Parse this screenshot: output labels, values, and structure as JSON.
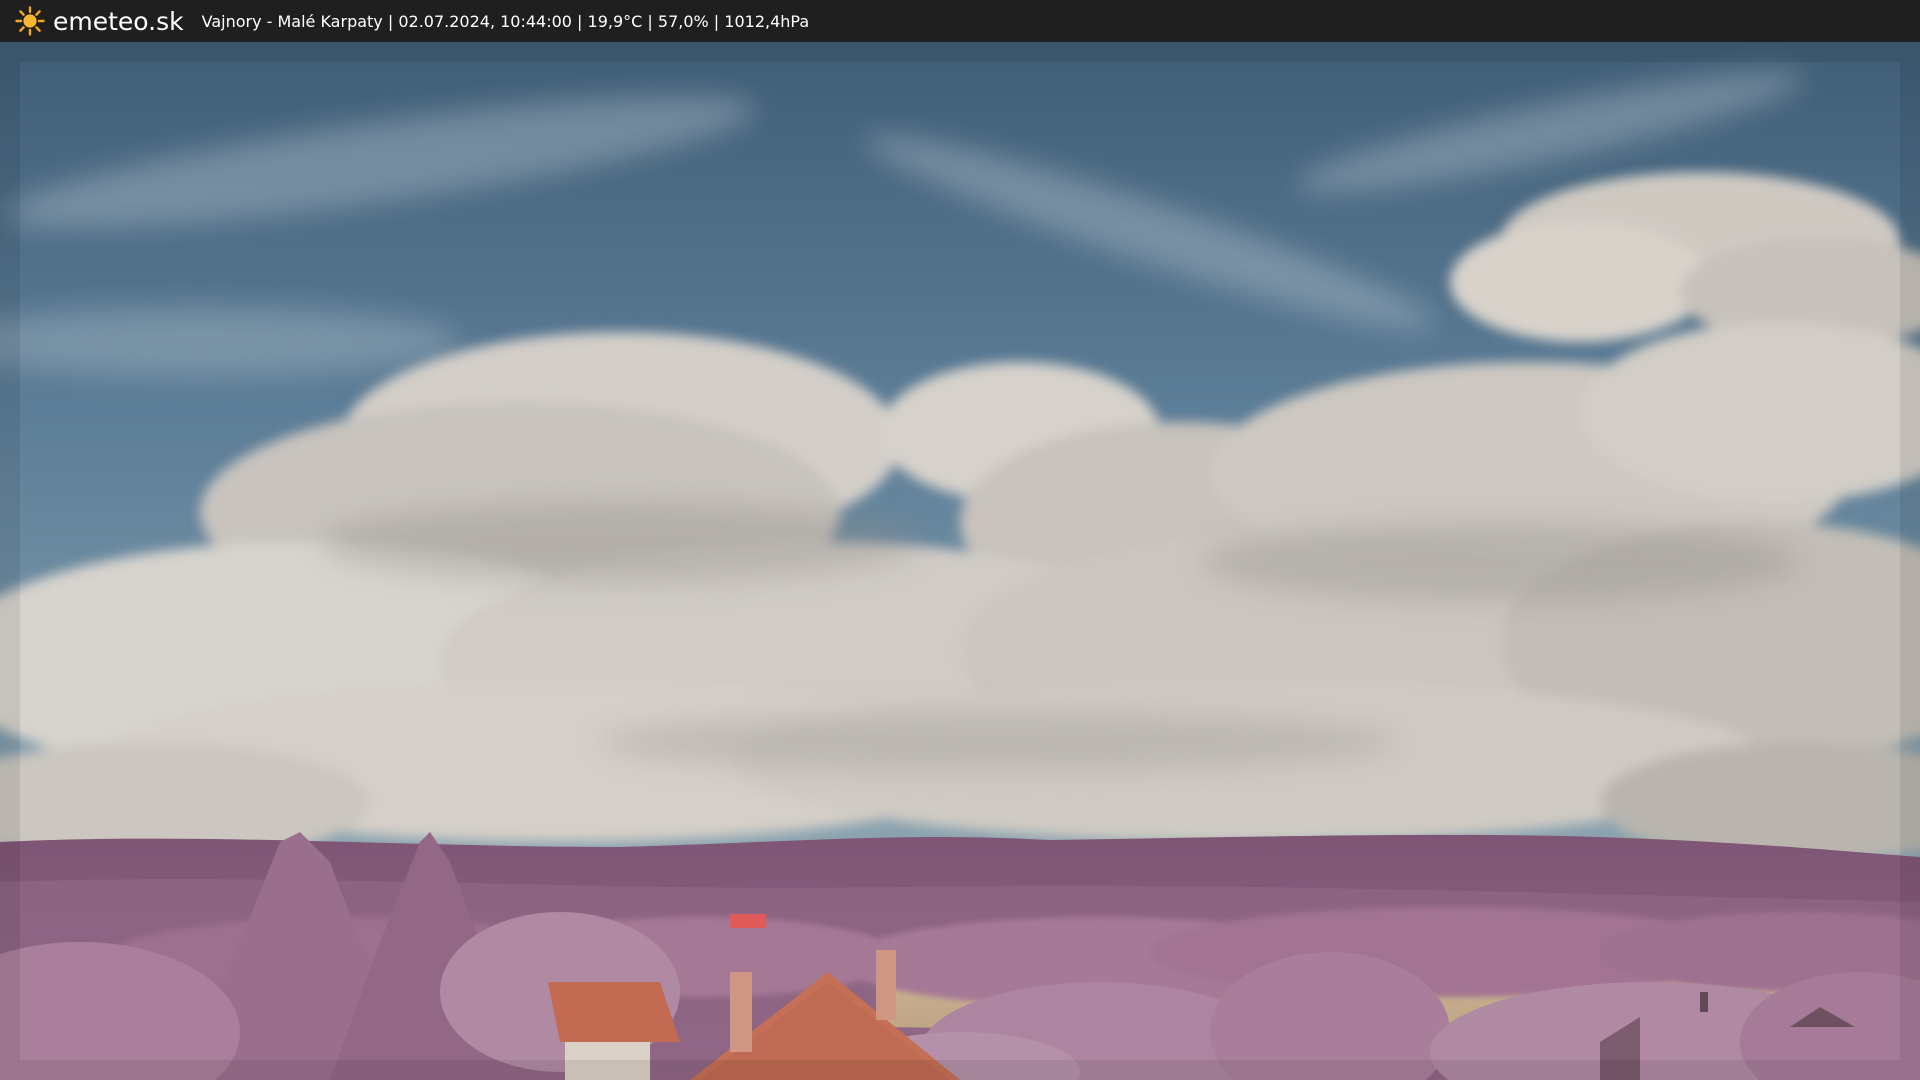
{
  "header": {
    "site_name": "emeteo.sk",
    "logo_icon": "sun-icon",
    "caption": "Vajnory - Malé Karpaty | 02.07.2024, 10:44:00 | 19,9°C | 57,0% | 1012,4hPa"
  },
  "colors": {
    "bar_background": "#1f1f1f",
    "sky_top": "#3c5a72",
    "sky_mid": "#6a8aa3",
    "cloud": "#d8d3cc",
    "foliage": "#a0708f",
    "roof": "#c26a52",
    "logo_sun": "#f5a623"
  }
}
